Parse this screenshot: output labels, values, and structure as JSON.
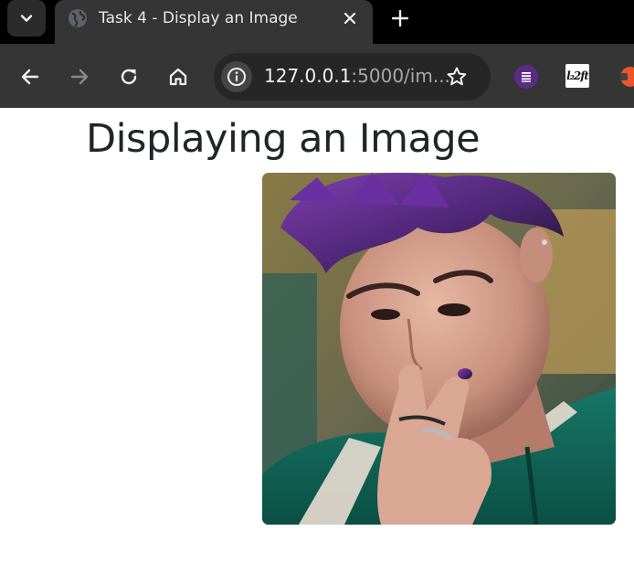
{
  "browser": {
    "tab_title": "Task 4 - Display an Image",
    "address": {
      "host": "127.0.0.1",
      "rest": ":5000/im..."
    },
    "extension_label": "l₂2ft",
    "icons": {
      "tab_search": "chevron-down-icon",
      "favicon": "globe-icon",
      "close": "close-icon",
      "new_tab": "plus-icon",
      "back": "arrow-left-icon",
      "forward": "arrow-right-icon",
      "reload": "reload-icon",
      "home": "home-icon",
      "site_info": "info-icon",
      "bookmark": "star-icon"
    }
  },
  "page": {
    "heading": "Displaying an Image",
    "image": {
      "description_role": "photo",
      "accent_color": "#6b2fa3"
    }
  },
  "colors": {
    "tab_bar": "#000000",
    "toolbar": "#353535",
    "omnibox": "#262626",
    "heading": "#212529"
  }
}
